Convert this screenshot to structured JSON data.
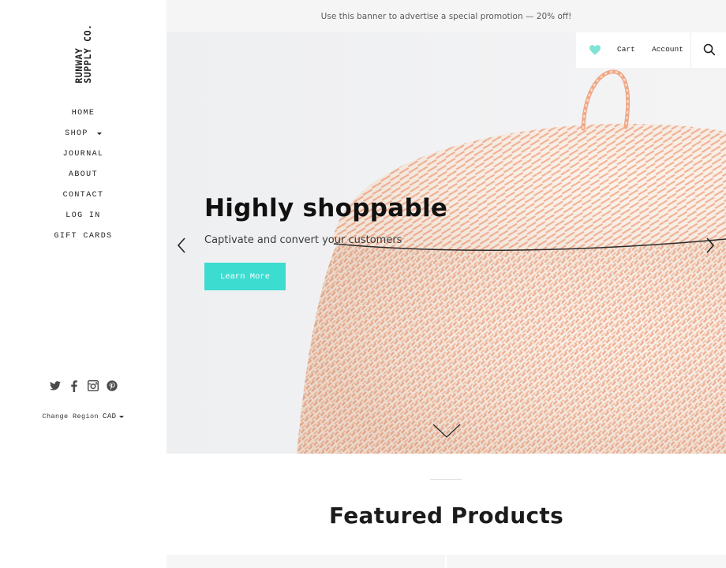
{
  "brand": {
    "logo_line1": "RUNWAY",
    "logo_line2": "SUPPLY CO."
  },
  "sidebar": {
    "nav": [
      {
        "label": "HOME"
      },
      {
        "label": "SHOP",
        "has_dropdown": true
      },
      {
        "label": "JOURNAL"
      },
      {
        "label": "ABOUT"
      },
      {
        "label": "CONTACT"
      },
      {
        "label": "LOG IN"
      },
      {
        "label": "GIFT CARDS"
      }
    ],
    "social_icons": [
      "twitter-icon",
      "facebook-icon",
      "instagram-icon",
      "pinterest-icon"
    ],
    "region": {
      "label": "Change Region",
      "currency": "CAD"
    }
  },
  "announcement": {
    "text": "Use this banner to advertise a special promotion — 20% off!"
  },
  "header": {
    "wishlist_icon": "heart-icon",
    "cart_label": "Cart",
    "account_label": "Account",
    "search_icon": "search-icon"
  },
  "hero": {
    "title": "Highly shoppable",
    "subtitle": "Captivate and convert your customers",
    "button_label": "Learn More",
    "prev_icon": "chevron-left-icon",
    "next_icon": "chevron-right-icon",
    "scroll_icon": "chevron-down-icon"
  },
  "featured": {
    "title": "Featured Products"
  },
  "colors": {
    "accent": "#3ddcd0",
    "heart": "#7fe3d5",
    "announcement_bg": "#f5f5f5",
    "basket_weave": "#f0a887"
  }
}
